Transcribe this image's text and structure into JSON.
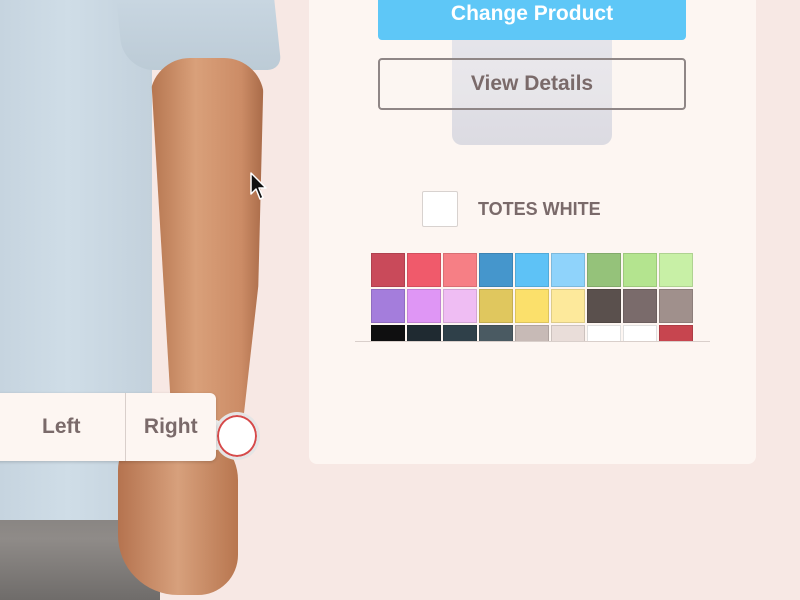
{
  "product": {
    "change_label": "Change Product",
    "details_label": "View Details"
  },
  "color": {
    "selected_name": "TOTES WHITE",
    "selected_hex": "#ffffff",
    "swatches": [
      "#c94a5a",
      "#f05a6b",
      "#f67f85",
      "#4596cc",
      "#5ec2f6",
      "#8fd3fb",
      "#95c27a",
      "#b4e48f",
      "#c8f0a6",
      "#a47ddc",
      "#df96f5",
      "#efbdf3",
      "#e0c75e",
      "#fbe06b",
      "#fde99b",
      "#5a504d",
      "#7a6b6b",
      "#a0908c",
      "#0f0f10",
      "#1f2a31",
      "#2f4049",
      "#4a5a62",
      "#c7bab6",
      "#e9ddd9",
      "#ffffff",
      "#ffffff",
      "#c7454f"
    ]
  },
  "angle": {
    "left_label": "Left",
    "right_label": "Right"
  }
}
